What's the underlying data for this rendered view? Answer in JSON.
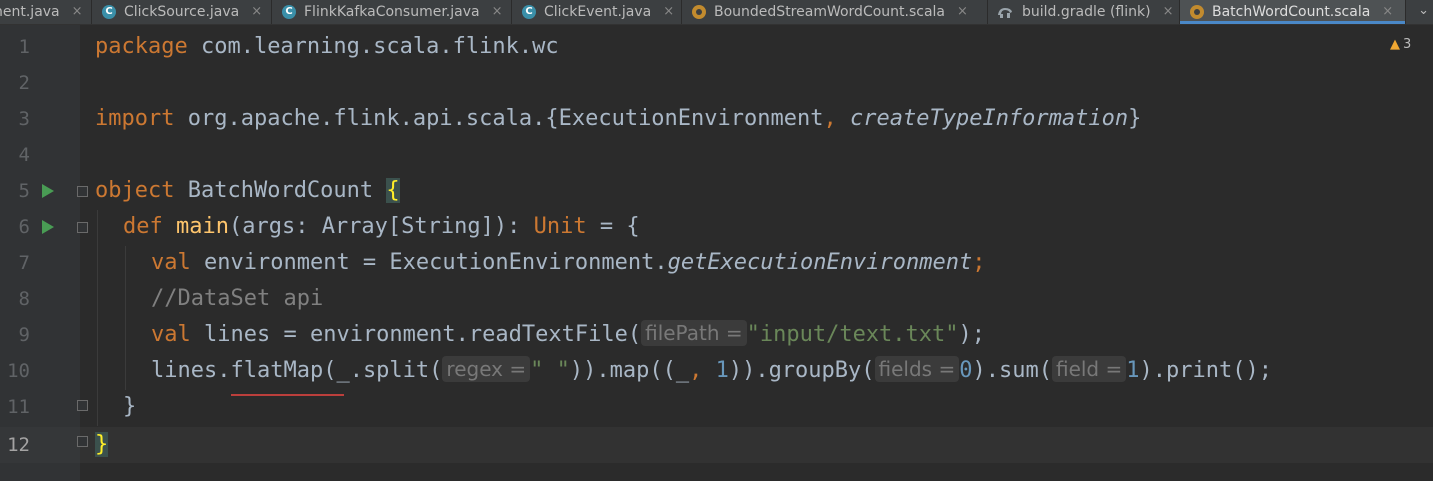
{
  "tabs": [
    {
      "label": "nent.java",
      "icon": "java-class-icon",
      "active": false
    },
    {
      "label": "ClickSource.java",
      "icon": "java-class-icon",
      "active": false
    },
    {
      "label": "FlinkKafkaConsumer.java",
      "icon": "java-class-icon",
      "active": false
    },
    {
      "label": "ClickEvent.java",
      "icon": "java-class-icon",
      "active": false
    },
    {
      "label": "BoundedStreamWordCount.scala",
      "icon": "scala-object-icon",
      "active": false
    },
    {
      "label": "build.gradle (flink)",
      "icon": "gradle-icon",
      "active": false
    },
    {
      "label": "BatchWordCount.scala",
      "icon": "scala-object-icon",
      "active": true
    }
  ],
  "close_glyph": "×",
  "overflow_glyph": "⌄",
  "warnings": {
    "count": "3",
    "icon": "warning-icon"
  },
  "line_numbers": [
    "1",
    "2",
    "3",
    "4",
    "5",
    "6",
    "7",
    "8",
    "9",
    "10",
    "11",
    "12"
  ],
  "code": {
    "l1_kw": "package",
    "l1_rest": " com.learning.scala.flink.wc",
    "l3_kw": "import",
    "l3_rest": " org.apache.flink.api.scala.{ExecutionEnvironment",
    "l3_comma": ",",
    "l3_ital": " createTypeInformation",
    "l3_end": "}",
    "l5_kw": "object",
    "l5_rest": " BatchWordCount ",
    "l5_brace": "{",
    "l6_kw": "def",
    "l6_fn": "main",
    "l6_rest": "(args: Array[String]): ",
    "l6_type": "Unit",
    "l6_end": " = {",
    "l7_kw": "val",
    "l7_rest": " environment = ExecutionEnvironment.",
    "l7_ital": "getExecutionEnvironment",
    "l7_semi": ";",
    "l8_comment": "//DataSet api",
    "l9_kw": "val",
    "l9_rest": " lines = environment.readTextFile(",
    "l9_hint": "filePath =",
    "l9_str": "\"input/text.txt\"",
    "l9_end": ");",
    "l10_a": "lines.",
    "l10_flat": "flatMap",
    "l10_b": "(_.split(",
    "l10_hint1": "regex =",
    "l10_str": "\" \"",
    "l10_c": ")).map((_",
    "l10_comma": ",",
    "l10_num1": " 1",
    "l10_d": ")).groupBy(",
    "l10_hint2": "fields =",
    "l10_num2": "0",
    "l10_e": ").sum(",
    "l10_hint3": "field =",
    "l10_num3": "1",
    "l10_f": ").print();",
    "l11": "}",
    "l12": "}"
  }
}
